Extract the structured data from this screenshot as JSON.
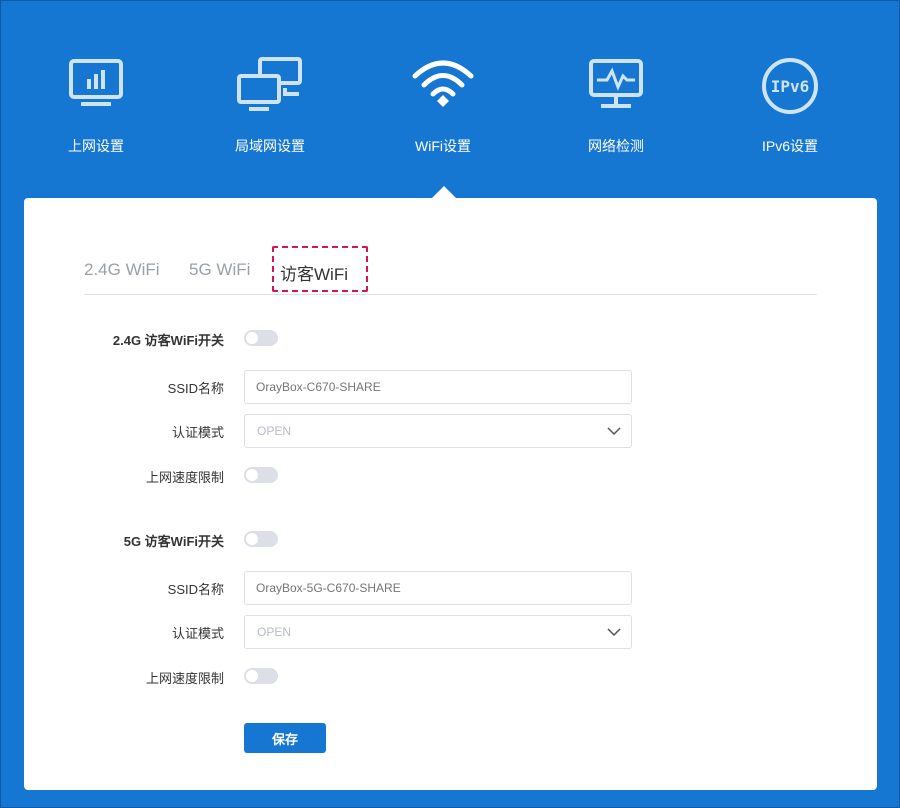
{
  "nav": {
    "items": [
      {
        "label": "上网设置",
        "icon": "monitor-chart-icon"
      },
      {
        "label": "局域网设置",
        "icon": "lan-computers-icon"
      },
      {
        "label": "WiFi设置",
        "icon": "wifi-icon"
      },
      {
        "label": "网络检测",
        "icon": "monitor-pulse-icon"
      },
      {
        "label": "IPv6设置",
        "icon": "ipv6-icon",
        "icon_text": "IPv6"
      }
    ],
    "active_index": 2
  },
  "tabs": [
    {
      "label": "2.4G WiFi"
    },
    {
      "label": "5G WiFi"
    },
    {
      "label": "访客WiFi"
    }
  ],
  "active_tab": 2,
  "guest_24g": {
    "switch_label": "2.4G 访客WiFi开关",
    "switch_on": false,
    "ssid_label": "SSID名称",
    "ssid_placeholder": "OrayBox-C670-SHARE",
    "auth_label": "认证模式",
    "auth_value": "OPEN",
    "speed_label": "上网速度限制",
    "speed_on": false
  },
  "guest_5g": {
    "switch_label": "5G 访客WiFi开关",
    "switch_on": false,
    "ssid_label": "SSID名称",
    "ssid_placeholder": "OrayBox-5G-C670-SHARE",
    "auth_label": "认证模式",
    "auth_value": "OPEN",
    "speed_label": "上网速度限制",
    "speed_on": false
  },
  "save_label": "保存",
  "colors": {
    "brand_blue": "#1677d2",
    "focus_outline": "#d4145a"
  }
}
